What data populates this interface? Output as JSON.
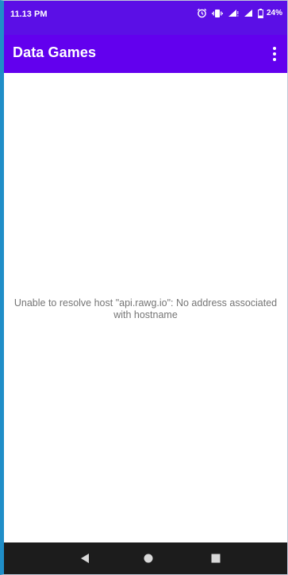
{
  "status_bar": {
    "time": "11.13 PM",
    "battery_percent": "24%",
    "icons": [
      "alarm-icon",
      "vibrate-icon",
      "signal-icon",
      "signal-icon",
      "battery-icon"
    ]
  },
  "app_bar": {
    "title": "Data Games",
    "menu_icon": "more-vert-icon"
  },
  "content": {
    "error_message": "Unable to resolve host \"api.rawg.io\": No address associated with hostname"
  },
  "nav_bar": {
    "buttons": [
      "back-icon",
      "home-icon",
      "recents-icon"
    ]
  },
  "colors": {
    "status_bar": "#5b0fe6",
    "app_bar": "#6200ee",
    "error_text": "#757575",
    "nav_bar": "#1c1c1c"
  }
}
